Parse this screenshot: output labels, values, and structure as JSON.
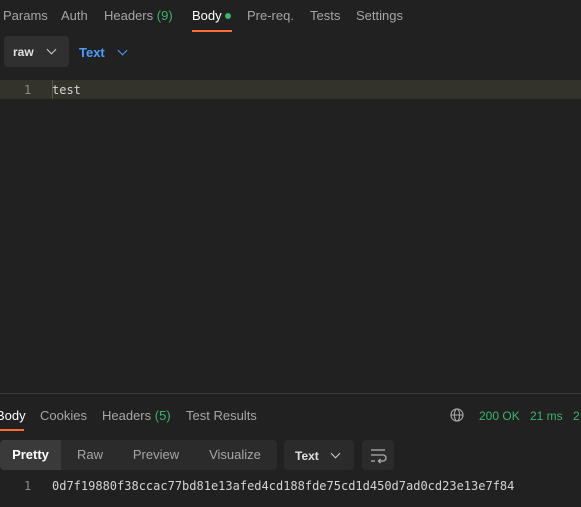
{
  "request_tabs": [
    {
      "label": "Params"
    },
    {
      "label": "Auth"
    },
    {
      "label": "Headers",
      "count": "(9)"
    },
    {
      "label": "Body"
    },
    {
      "label": "Pre-req."
    },
    {
      "label": "Tests"
    },
    {
      "label": "Settings"
    }
  ],
  "body_mode": {
    "selected": "raw",
    "language": "Text"
  },
  "editor": {
    "lines": [
      {
        "number": "1",
        "text": "test"
      }
    ]
  },
  "response_tabs": [
    {
      "label": "Body"
    },
    {
      "label": "Cookies"
    },
    {
      "label": "Headers",
      "count": "(5)"
    },
    {
      "label": "Test Results"
    }
  ],
  "response_status": {
    "status": "200 OK",
    "time": "21 ms",
    "size_partial": "2"
  },
  "response_view": {
    "modes": [
      "Pretty",
      "Raw",
      "Preview",
      "Visualize"
    ],
    "format": "Text"
  },
  "response_body": {
    "lines": [
      {
        "number": "1",
        "text": "0d7f19880f38ccac77bd81e13afed4cd188fde75cd1d450d7ad0cd23e13e7f84"
      }
    ]
  },
  "colors": {
    "accent": "#ff6c37",
    "success": "#3db36c",
    "link": "#4a9cff"
  }
}
